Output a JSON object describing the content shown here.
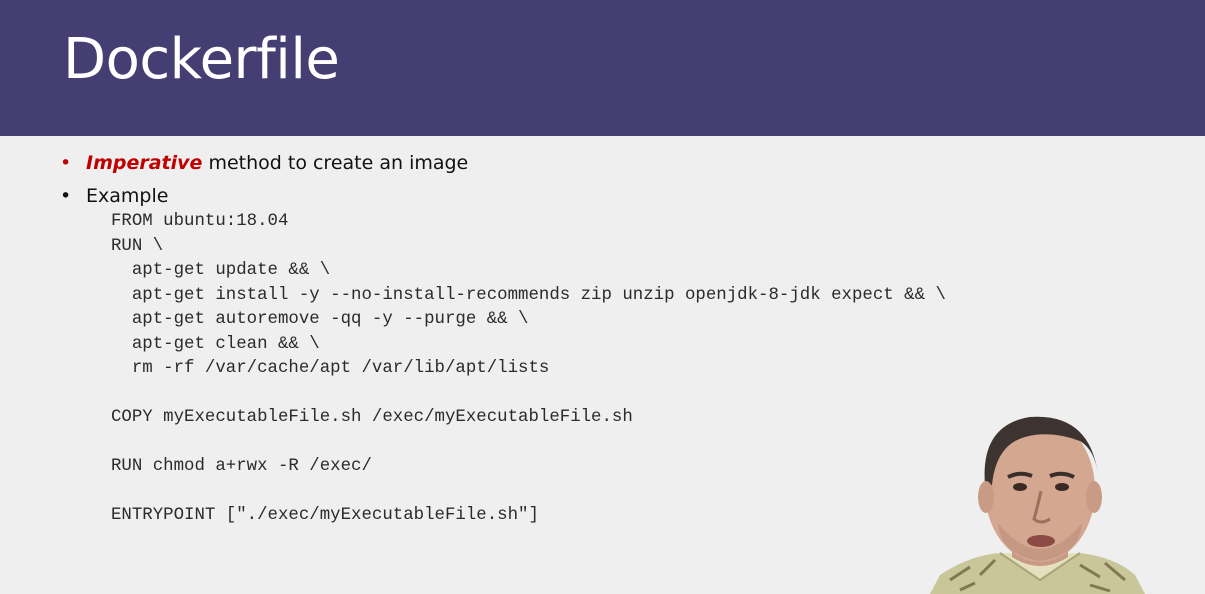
{
  "slide": {
    "title": "Dockerfile",
    "bullets": [
      {
        "emphasis": "Imperative",
        "text": " method to create an image"
      },
      {
        "text": "Example"
      }
    ],
    "bullet_glyph": "•",
    "code_lines": [
      "FROM ubuntu:18.04",
      "RUN \\",
      "  apt-get update && \\",
      "  apt-get install -y --no-install-recommends zip unzip openjdk-8-jdk expect && \\",
      "  apt-get autoremove -qq -y --purge && \\",
      "  apt-get clean && \\",
      "  rm -rf /var/cache/apt /var/lib/apt/lists",
      "",
      "COPY myExecutableFile.sh /exec/myExecutableFile.sh",
      "",
      "RUN chmod a+rwx -R /exec/",
      "",
      "ENTRYPOINT [\"./exec/myExecutableFile.sh\"]"
    ]
  },
  "colors": {
    "header_bg": "#453e72",
    "accent_red": "#c00000",
    "slide_bg": "#efefef"
  }
}
